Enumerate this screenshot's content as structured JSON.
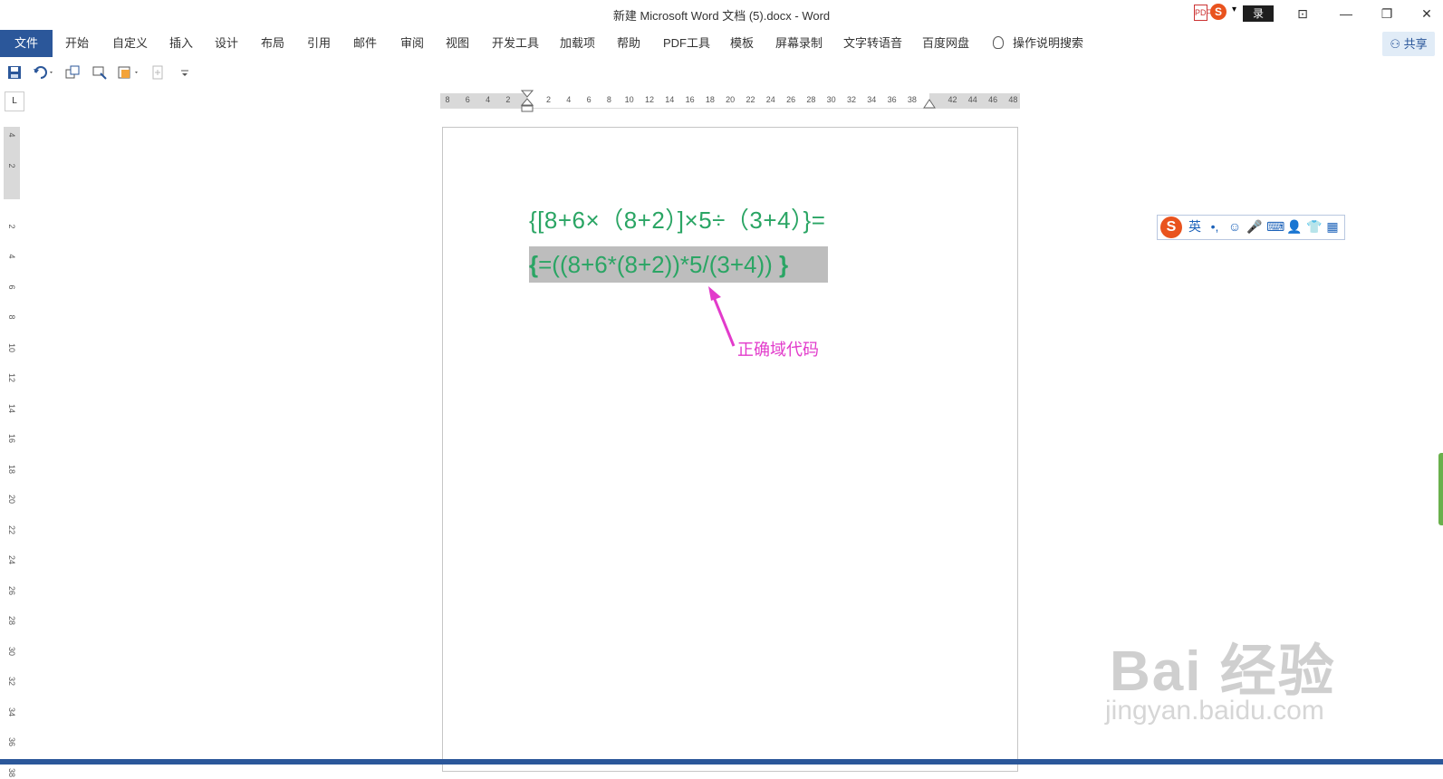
{
  "window": {
    "title": "新建 Microsoft Word 文档 (5).docx  -  Word",
    "ime_mini": {
      "pdf_label": "PDF",
      "sogou_label": "S",
      "arrow": "▾",
      "login_label": "录"
    },
    "controls": {
      "ribbon_display": "⊡",
      "minimize": "—",
      "restore": "❐",
      "close": "✕"
    }
  },
  "ribbon": {
    "file_tab": "文件",
    "tabs": [
      "开始",
      "自定义",
      "插入",
      "设计",
      "布局",
      "引用",
      "邮件",
      "审阅",
      "视图",
      "开发工具",
      "加载项",
      "帮助",
      "PDF工具",
      "模板",
      "屏幕录制",
      "文字转语音",
      "百度网盘"
    ],
    "tell_me": "操作说明搜索",
    "share": "共享"
  },
  "qat": {
    "icons": [
      "save-icon",
      "undo-icon",
      "copy-format-icon",
      "repeat-icon",
      "layout-icon",
      "new-doc-icon",
      "customize-icon"
    ]
  },
  "ruler": {
    "corner": "L",
    "horizontal_ticks": [
      "8",
      "6",
      "4",
      "2",
      "",
      "2",
      "4",
      "6",
      "8",
      "10",
      "12",
      "14",
      "16",
      "18",
      "20",
      "22",
      "24",
      "26",
      "28",
      "30",
      "32",
      "34",
      "36",
      "38",
      "",
      "42",
      "44",
      "46",
      "48"
    ],
    "vertical_ticks": [
      "4",
      "2",
      "",
      "2",
      "4",
      "6",
      "8",
      "10",
      "12",
      "14",
      "16",
      "18",
      "20",
      "22",
      "24",
      "26",
      "28",
      "30",
      "32",
      "34",
      "36",
      "38"
    ]
  },
  "document": {
    "line1": "{[8+6×（8+2）]×5÷（3+4）}=",
    "line2_open": "{",
    "line2_code": "=((8+6*(8+2))*5/(3+4)) ",
    "line2_close": "}",
    "annotation": "正确域代码",
    "colors": {
      "text": "#2aa564",
      "field_shade": "#bdbdbd",
      "annotation": "#e23bcb"
    }
  },
  "ime_bar": {
    "logo": "S",
    "items": [
      "英",
      "•,",
      "☺",
      "🎤",
      "⌨",
      "👤",
      "👕",
      "▦"
    ]
  },
  "watermark": {
    "logo": "Bai 经验",
    "url": "jingyan.baidu.com"
  }
}
